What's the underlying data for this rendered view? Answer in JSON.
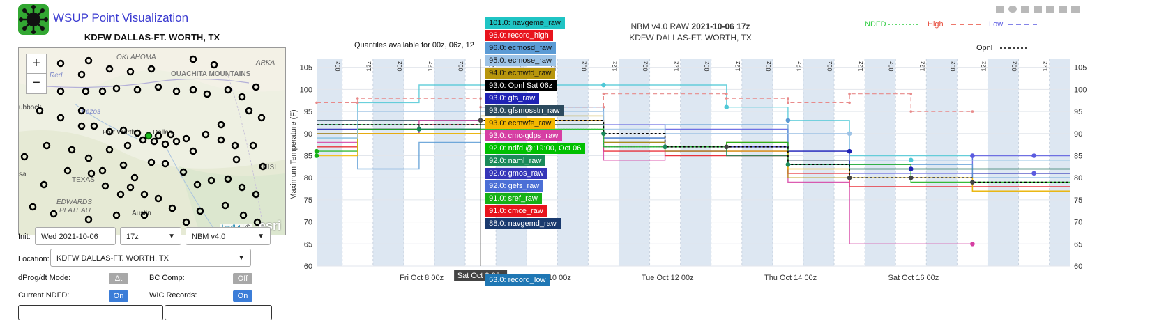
{
  "app": {
    "title": "WSUP Point Visualization",
    "station": "KDFW DALLAS-FT. WORTH, TX"
  },
  "map": {
    "zoom_in": "+",
    "zoom_out": "−",
    "labels": {
      "oklahoma": "OKLAHOMA",
      "ouachita": "OUACHITA MOUNTAINS",
      "arka": "ARKA",
      "red": "Red",
      "lubbock": "ubbock",
      "brazos": "Brazos",
      "fortworth": "Fort Worth",
      "dallas": "Dallas",
      "texas": "TEXAS",
      "luisi": "LUISI",
      "sa": "sa",
      "edwards": "EDWARDS",
      "plateau": "PLATEAU",
      "austin": "Austin",
      "esri": "esri"
    },
    "attribution": {
      "leaflet": "Leaflet",
      "sep": " | ©"
    }
  },
  "controls": {
    "init_label": "Init:",
    "init_date": "Wed 2021-10-06",
    "init_hour": "17z",
    "model": "NBM v4.0",
    "location_label": "Location:",
    "location": "KDFW DALLAS-FT. WORTH, TX",
    "dprog_label": "dProg/dt Mode:",
    "dprog_value": "Δt",
    "bc_label": "BC Comp:",
    "bc_value": "Off",
    "ndfd_label": "Current NDFD:",
    "ndfd_value": "On",
    "wic_label": "WIC Records:",
    "wic_value": "On"
  },
  "chart_data": {
    "type": "line",
    "title": "NBM v4.0 RAW",
    "title_bold": "2021-10-06 17z",
    "subtitle": "KDFW DALLAS-FT. WORTH, TX",
    "note": "Quantiles available for 00z, 06z, 12",
    "ylabel": "Maximum Temperature (F)",
    "ylim": [
      60,
      107
    ],
    "yticks": [
      60,
      65,
      70,
      75,
      80,
      85,
      90,
      95,
      100,
      105
    ],
    "xlim_hours": [
      -10,
      284
    ],
    "x_ticks": [
      {
        "h": 31,
        "label": "Fri Oct  8 00z"
      },
      {
        "h": 79,
        "label": "Sun Oct 10 00z"
      },
      {
        "h": 127,
        "label": "Tue Oct 12 00z"
      },
      {
        "h": 175,
        "label": "Thu Oct 14 00z"
      },
      {
        "h": 223,
        "label": "Sat Oct 16 00z"
      }
    ],
    "hover_label": "Sat Oct  9 06z",
    "legend": [
      {
        "name": "NDFD",
        "color": "#2ecc40",
        "dash": "2,3"
      },
      {
        "name": "High",
        "color": "#e74c3c",
        "dash": "7,5"
      },
      {
        "name": "Low",
        "color": "#5b5be0",
        "dash": "7,5"
      },
      {
        "name": "Opnl",
        "color": "#000000",
        "dash": "3,3"
      }
    ],
    "hover_values": [
      {
        "value": 101.0,
        "name": "navgeme_raw",
        "bg": "#1fc4c4",
        "fg": "#111"
      },
      {
        "value": 96.0,
        "name": "record_high",
        "bg": "#e8141d",
        "fg": "#fff"
      },
      {
        "value": 96.0,
        "name": "ecmosd_raw",
        "bg": "#5b9bd5",
        "fg": "#111"
      },
      {
        "value": 95.0,
        "name": "ecmose_raw",
        "bg": "#9dc3e6",
        "fg": "#111"
      },
      {
        "value": 94.0,
        "name": "ecmwfd_raw",
        "bg": "#b8960c",
        "fg": "#111"
      },
      {
        "value": 93.0,
        "name": "Opnl Sat 06z",
        "bg": "#000000",
        "fg": "#fff"
      },
      {
        "value": 93.0,
        "name": "gfs_raw",
        "bg": "#1f22b4",
        "fg": "#fff"
      },
      {
        "value": 93.0,
        "name": "gfsmosstn_raw",
        "bg": "#2c4a5e",
        "fg": "#fff"
      },
      {
        "value": 93.0,
        "name": "ecmwfe_raw",
        "bg": "#f4b800",
        "fg": "#111"
      },
      {
        "value": 93.0,
        "name": "cmc-gdps_raw",
        "bg": "#d63fa3",
        "fg": "#fff"
      },
      {
        "value": 92.0,
        "name": "ndfd @:19:00, Oct 06",
        "bg": "#00c000",
        "fg": "#fff"
      },
      {
        "value": 92.0,
        "name": "naml_raw",
        "bg": "#1a8a5a",
        "fg": "#fff"
      },
      {
        "value": 92.0,
        "name": "gmos_raw",
        "bg": "#3535b8",
        "fg": "#fff"
      },
      {
        "value": 92.0,
        "name": "gefs_raw",
        "bg": "#4b6fd6",
        "fg": "#fff"
      },
      {
        "value": 91.0,
        "name": "sref_raw",
        "bg": "#16b016",
        "fg": "#fff"
      },
      {
        "value": 91.0,
        "name": "cmce_raw",
        "bg": "#e8141d",
        "fg": "#fff"
      },
      {
        "value": 88.0,
        "name": "navgemd_raw",
        "bg": "#1a3a6e",
        "fg": "#fff"
      },
      {
        "value": 53.0,
        "name": "record_low",
        "bg": "#1f77b4",
        "fg": "#fff"
      }
    ],
    "series": [
      {
        "color": "#4fc8d6",
        "points": [
          [
            -10,
            89
          ],
          [
            6,
            89
          ],
          [
            6,
            97
          ],
          [
            30,
            97
          ],
          [
            30,
            101
          ],
          [
            150,
            101
          ],
          [
            150,
            96
          ],
          [
            174,
            96
          ],
          [
            174,
            93
          ],
          [
            198,
            93
          ],
          [
            198,
            85
          ],
          [
            246,
            85
          ],
          [
            246,
            84
          ],
          [
            284,
            84
          ]
        ]
      },
      {
        "color": "#5b5be0",
        "points": [
          [
            -10,
            90
          ],
          [
            30,
            90
          ],
          [
            30,
            92
          ],
          [
            126,
            92
          ],
          [
            126,
            91
          ],
          [
            174,
            91
          ],
          [
            174,
            86
          ],
          [
            198,
            86
          ],
          [
            198,
            81
          ],
          [
            246,
            81
          ],
          [
            246,
            85
          ],
          [
            284,
            85
          ]
        ]
      },
      {
        "color": "#2c4a5e",
        "points": [
          [
            -10,
            93
          ],
          [
            54,
            93
          ],
          [
            54,
            92
          ],
          [
            102,
            92
          ],
          [
            102,
            88
          ],
          [
            126,
            88
          ],
          [
            126,
            86
          ],
          [
            174,
            86
          ],
          [
            174,
            84
          ],
          [
            198,
            84
          ],
          [
            198,
            82
          ],
          [
            246,
            82
          ],
          [
            246,
            82
          ],
          [
            284,
            82
          ]
        ]
      },
      {
        "color": "#e8141d",
        "points": [
          [
            -10,
            87
          ],
          [
            6,
            87
          ],
          [
            6,
            91
          ],
          [
            30,
            91
          ],
          [
            30,
            92
          ],
          [
            102,
            92
          ],
          [
            102,
            86
          ],
          [
            126,
            86
          ],
          [
            126,
            85
          ],
          [
            150,
            85
          ],
          [
            150,
            85
          ],
          [
            174,
            85
          ],
          [
            174,
            81
          ],
          [
            198,
            81
          ],
          [
            198,
            78
          ],
          [
            246,
            78
          ],
          [
            246,
            78
          ],
          [
            284,
            78
          ]
        ]
      },
      {
        "color": "#d63fa3",
        "points": [
          [
            -10,
            88
          ],
          [
            6,
            88
          ],
          [
            6,
            90
          ],
          [
            30,
            90
          ],
          [
            30,
            93
          ],
          [
            102,
            93
          ],
          [
            102,
            84
          ],
          [
            126,
            84
          ],
          [
            126,
            86
          ],
          [
            174,
            86
          ],
          [
            174,
            79
          ],
          [
            198,
            79
          ],
          [
            198,
            65
          ],
          [
            246,
            65
          ]
        ]
      },
      {
        "color": "#1f22b4",
        "points": [
          [
            -10,
            91
          ],
          [
            54,
            91
          ],
          [
            54,
            93
          ],
          [
            102,
            93
          ],
          [
            102,
            89
          ],
          [
            126,
            89
          ],
          [
            126,
            87
          ],
          [
            150,
            87
          ],
          [
            150,
            87
          ],
          [
            174,
            87
          ],
          [
            174,
            86
          ],
          [
            198,
            86
          ],
          [
            198,
            80
          ],
          [
            246,
            80
          ],
          [
            246,
            81
          ],
          [
            284,
            81
          ]
        ]
      },
      {
        "color": "#b8960c",
        "points": [
          [
            -10,
            90
          ],
          [
            54,
            90
          ],
          [
            54,
            94
          ],
          [
            102,
            94
          ],
          [
            102,
            88
          ],
          [
            126,
            88
          ],
          [
            126,
            86
          ],
          [
            150,
            86
          ],
          [
            150,
            88
          ],
          [
            174,
            88
          ],
          [
            174,
            80
          ],
          [
            198,
            80
          ],
          [
            198,
            80
          ],
          [
            246,
            80
          ],
          [
            246,
            77
          ],
          [
            284,
            77
          ]
        ]
      },
      {
        "color": "#5b9bd5",
        "points": [
          [
            -10,
            92
          ],
          [
            6,
            92
          ],
          [
            6,
            82
          ],
          [
            30,
            82
          ],
          [
            30,
            88
          ],
          [
            54,
            88
          ],
          [
            54,
            96
          ],
          [
            102,
            96
          ],
          [
            102,
            89
          ],
          [
            126,
            89
          ],
          [
            126,
            92
          ],
          [
            174,
            92
          ],
          [
            174,
            83
          ],
          [
            198,
            83
          ],
          [
            198,
            83
          ],
          [
            246,
            83
          ],
          [
            246,
            80
          ],
          [
            284,
            80
          ]
        ]
      },
      {
        "color": "#16b016",
        "points": [
          [
            -10,
            86
          ],
          [
            6,
            86
          ],
          [
            6,
            91
          ],
          [
            54,
            91
          ],
          [
            54,
            91
          ],
          [
            102,
            91
          ],
          [
            102,
            87
          ],
          [
            126,
            87
          ],
          [
            126,
            87
          ],
          [
            150,
            87
          ],
          [
            150,
            88
          ],
          [
            174,
            88
          ],
          [
            174,
            83
          ],
          [
            198,
            83
          ],
          [
            198,
            83
          ],
          [
            222,
            83
          ],
          [
            222,
            79
          ],
          [
            284,
            79
          ]
        ]
      },
      {
        "color": "#f4b800",
        "points": [
          [
            -10,
            85
          ],
          [
            6,
            85
          ],
          [
            6,
            90
          ],
          [
            54,
            90
          ],
          [
            54,
            93
          ],
          [
            102,
            93
          ],
          [
            102,
            87
          ],
          [
            150,
            87
          ],
          [
            150,
            86
          ],
          [
            174,
            86
          ],
          [
            174,
            82
          ],
          [
            198,
            82
          ],
          [
            198,
            80
          ],
          [
            246,
            80
          ],
          [
            246,
            77
          ],
          [
            284,
            77
          ]
        ]
      },
      {
        "color": "#9dc3e6",
        "points": [
          [
            -10,
            89
          ],
          [
            6,
            89
          ],
          [
            6,
            95
          ],
          [
            54,
            95
          ],
          [
            54,
            95
          ],
          [
            102,
            95
          ],
          [
            102,
            91
          ],
          [
            126,
            91
          ],
          [
            126,
            90
          ],
          [
            174,
            90
          ],
          [
            174,
            90
          ],
          [
            198,
            90
          ],
          [
            198,
            84
          ],
          [
            246,
            84
          ],
          [
            246,
            84
          ],
          [
            284,
            84
          ]
        ]
      },
      {
        "color": "#1a8a5a",
        "points": [
          [
            -10,
            92
          ],
          [
            30,
            92
          ],
          [
            30,
            91
          ],
          [
            54,
            91
          ],
          [
            54,
            92
          ],
          [
            102,
            92
          ],
          [
            102,
            87
          ],
          [
            126,
            87
          ],
          [
            126,
            87
          ],
          [
            150,
            87
          ],
          [
            150,
            85
          ],
          [
            174,
            85
          ],
          [
            174,
            83
          ],
          [
            198,
            83
          ],
          [
            198,
            82
          ],
          [
            246,
            82
          ],
          [
            246,
            82
          ],
          [
            284,
            82
          ]
        ]
      }
    ],
    "ndfd": [
      [
        -10,
        92
      ],
      [
        54,
        92
      ],
      [
        54,
        91
      ],
      [
        102,
        91
      ],
      [
        102,
        87
      ],
      [
        150,
        87
      ]
    ],
    "opnl": [
      [
        -10,
        92
      ],
      [
        54,
        92
      ],
      [
        54,
        93
      ],
      [
        102,
        93
      ],
      [
        102,
        90
      ],
      [
        126,
        90
      ],
      [
        126,
        87
      ],
      [
        174,
        87
      ],
      [
        174,
        83
      ],
      [
        198,
        83
      ],
      [
        198,
        80
      ],
      [
        246,
        80
      ],
      [
        246,
        79
      ],
      [
        284,
        79
      ]
    ],
    "record_high": [
      [
        -10,
        97
      ],
      [
        6,
        97
      ],
      [
        6,
        98
      ],
      [
        54,
        98
      ],
      [
        54,
        96
      ],
      [
        102,
        96
      ],
      [
        102,
        99
      ],
      [
        150,
        99
      ],
      [
        150,
        98
      ],
      [
        174,
        98
      ],
      [
        174,
        97
      ],
      [
        198,
        97
      ],
      [
        198,
        99
      ],
      [
        222,
        99
      ],
      [
        222,
        95
      ],
      [
        246,
        95
      ]
    ],
    "record_low": [
      [
        -10,
        53
      ],
      [
        284,
        53
      ]
    ],
    "markers": [
      {
        "x": 30,
        "y": 91,
        "color": "#1a8a5a"
      },
      {
        "x": 54,
        "y": 93,
        "color": "#444"
      },
      {
        "x": 102,
        "y": 90,
        "color": "#1a8a5a"
      },
      {
        "x": 126,
        "y": 87,
        "color": "#1a8a5a"
      },
      {
        "x": 150,
        "y": 87,
        "color": "#444"
      },
      {
        "x": 174,
        "y": 83,
        "color": "#1a8a5a"
      },
      {
        "x": 198,
        "y": 80,
        "color": "#444"
      },
      {
        "x": 222,
        "y": 80,
        "color": "#444"
      },
      {
        "x": 246,
        "y": 79,
        "color": "#444"
      },
      {
        "x": 102,
        "y": 101,
        "color": "#4fc8d6"
      },
      {
        "x": 150,
        "y": 96,
        "color": "#4fc8d6"
      },
      {
        "x": 174,
        "y": 93,
        "color": "#5b9bd5"
      },
      {
        "x": 198,
        "y": 90,
        "color": "#9dc3e6"
      },
      {
        "x": 198,
        "y": 86,
        "color": "#1f22b4"
      },
      {
        "x": 222,
        "y": 84,
        "color": "#4fc8d6"
      },
      {
        "x": 222,
        "y": 82,
        "color": "#1f22b4"
      },
      {
        "x": 246,
        "y": 85,
        "color": "#5b5be0"
      },
      {
        "x": 246,
        "y": 65,
        "color": "#d63fa3"
      },
      {
        "x": 270,
        "y": 85,
        "color": "#5b5be0"
      },
      {
        "x": 270,
        "y": 81,
        "color": "#5b5be0"
      },
      {
        "x": -10,
        "y": 86,
        "color": "#16b016"
      },
      {
        "x": -10,
        "y": 85,
        "color": "#16b016"
      }
    ],
    "hover_x_hour": 54
  }
}
